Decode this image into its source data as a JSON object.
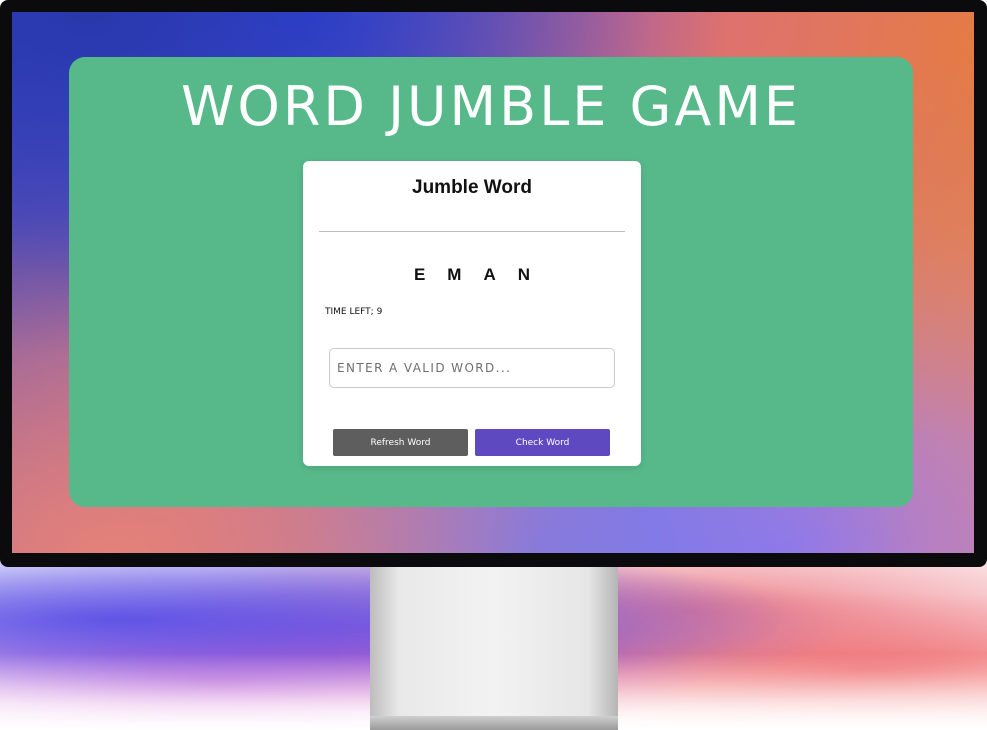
{
  "app": {
    "title": "WORD JUMBLE GAME"
  },
  "card": {
    "title": "Jumble Word",
    "jumbled_word": "EMAN",
    "time_left_label": "TIME LEFT;",
    "time_left_value": "9",
    "input": {
      "placeholder": "ENTER A VALID WORD...",
      "value": ""
    },
    "buttons": {
      "refresh_label": "Refresh Word",
      "check_label": "Check Word"
    }
  },
  "colors": {
    "app_background": "#57b98a",
    "card_background": "#ffffff",
    "refresh_button": "#5e5e5e",
    "check_button": "#5e49c1",
    "title_text": "#ffffff"
  }
}
